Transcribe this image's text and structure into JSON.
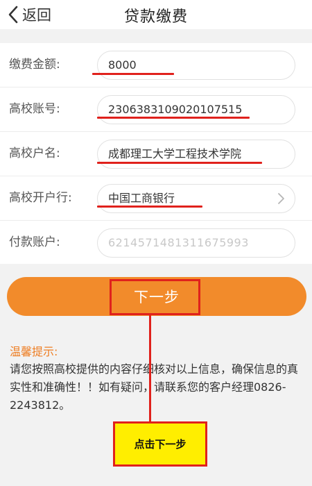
{
  "header": {
    "back_label": "返回",
    "title": "贷款缴费"
  },
  "form": {
    "rows": [
      {
        "label": "缴费金额:",
        "value": "8000"
      },
      {
        "label": "高校账号:",
        "value": "2306383109020107515"
      },
      {
        "label": "高校户名:",
        "value": "成都理工大学工程技术学院"
      },
      {
        "label": "高校开户行:",
        "value": "中国工商银行"
      },
      {
        "label": "付款账户:",
        "value": "6214571481311675993"
      }
    ]
  },
  "next_button": {
    "label": "下一步"
  },
  "tips": {
    "title": "温馨提示:",
    "body": "请您按照高校提供的内容仔细核对以上信息，确保信息的真实性和准确性！！如有疑问，请联系您的客户经理0826-2243812。"
  },
  "annotation": {
    "callout_text": "点击下一步"
  },
  "colors": {
    "accent": "#f28b2b",
    "tips_title": "#ee7d22",
    "annotation_red": "#e0211c",
    "callout_yellow": "#ffee00"
  },
  "icons": {
    "back": "chevron-left-icon",
    "bank_select": "chevron-right-icon"
  }
}
